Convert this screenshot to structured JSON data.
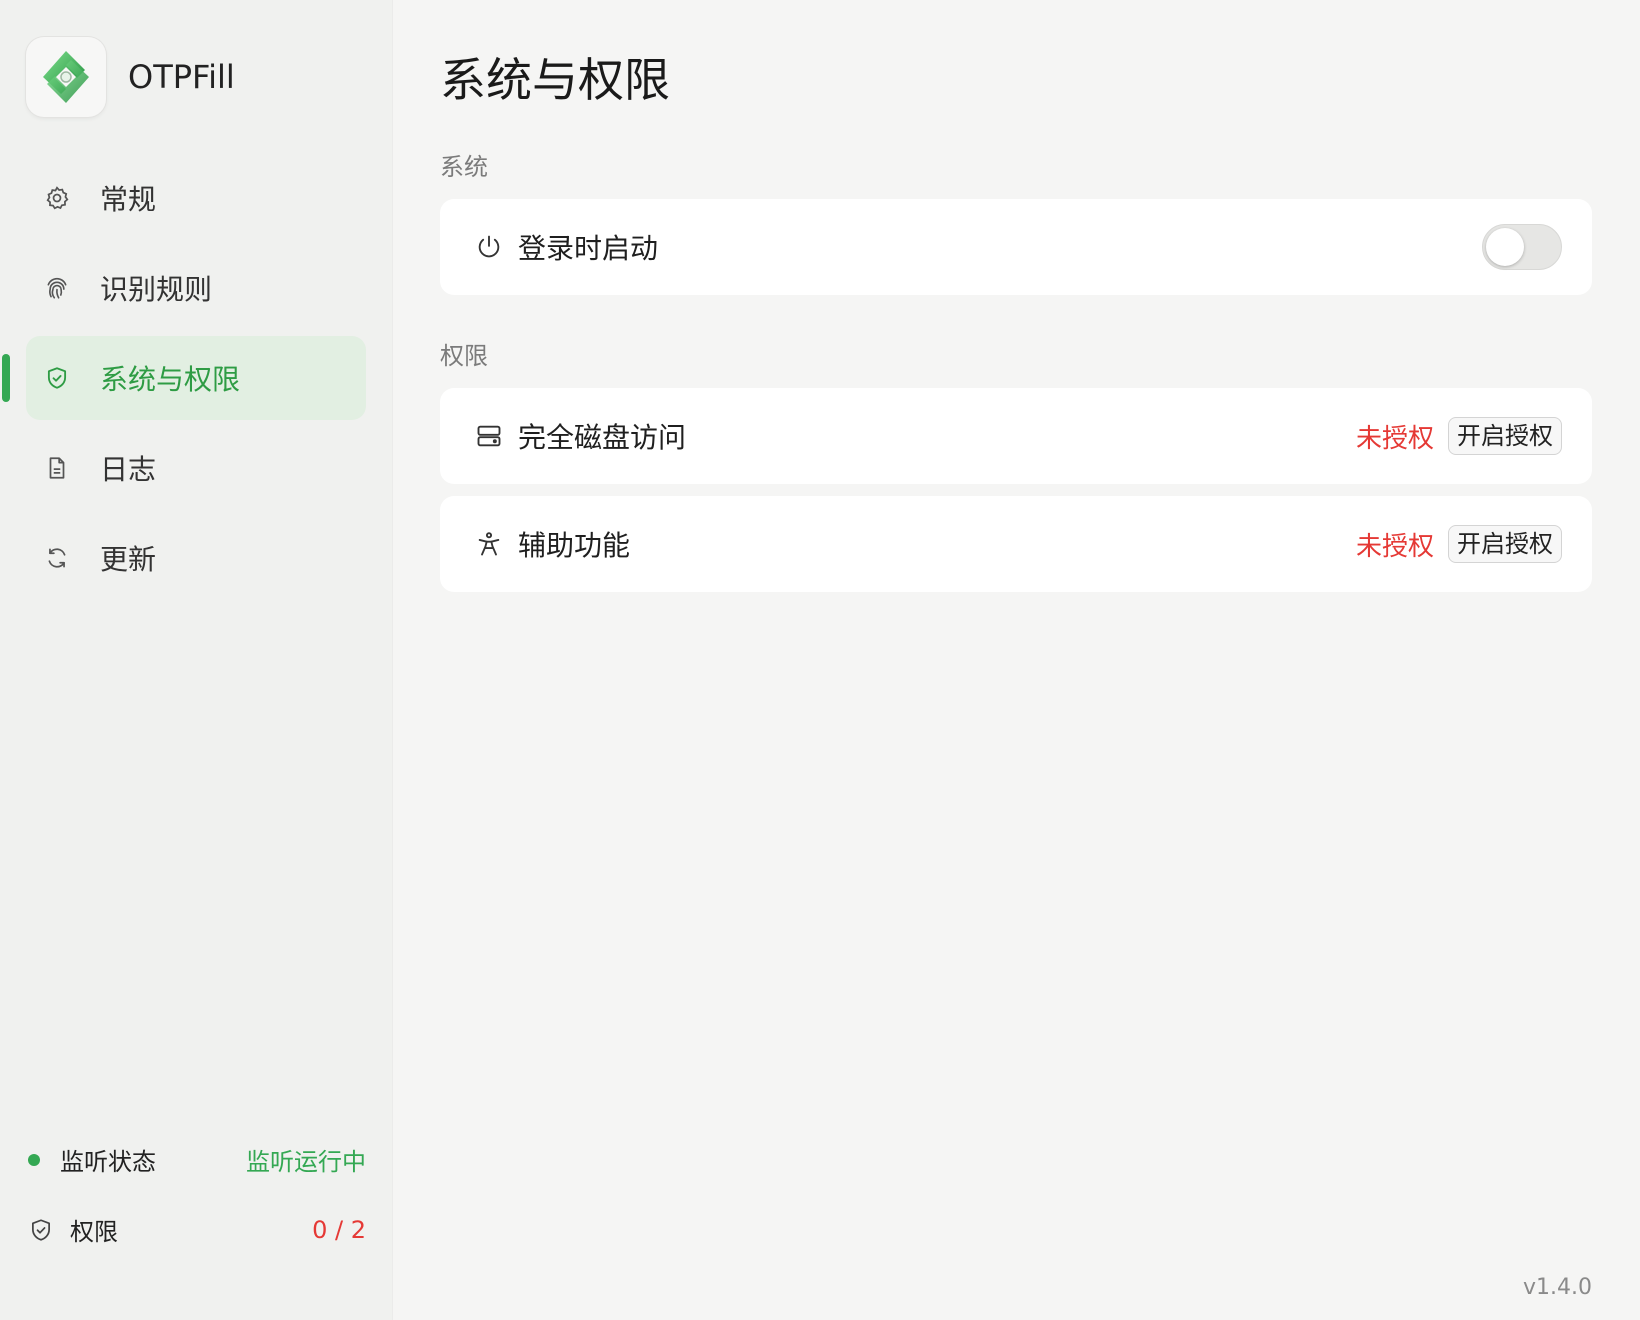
{
  "app": {
    "name": "OTPFill",
    "version": "v1.4.0"
  },
  "sidebar": {
    "items": [
      {
        "label": "常规",
        "icon": "gear-icon"
      },
      {
        "label": "识别规则",
        "icon": "fingerprint-icon"
      },
      {
        "label": "系统与权限",
        "icon": "shield-check-icon",
        "active": true
      },
      {
        "label": "日志",
        "icon": "document-icon"
      },
      {
        "label": "更新",
        "icon": "refresh-icon"
      }
    ],
    "status": {
      "listen_label": "监听状态",
      "listen_value": "监听运行中",
      "permission_label": "权限",
      "permission_value": "0 / 2"
    }
  },
  "main": {
    "title": "系统与权限",
    "system_section": {
      "label": "系统",
      "launch_at_login": {
        "label": "登录时启动",
        "enabled": false
      }
    },
    "permission_section": {
      "label": "权限",
      "items": [
        {
          "label": "完全磁盘访问",
          "status": "未授权",
          "action": "开启授权"
        },
        {
          "label": "辅助功能",
          "status": "未授权",
          "action": "开启授权"
        }
      ]
    }
  },
  "colors": {
    "accent": "#34a853",
    "accent_text": "#2e9c44",
    "active_bg": "#e2efe2",
    "error": "#e53935"
  }
}
